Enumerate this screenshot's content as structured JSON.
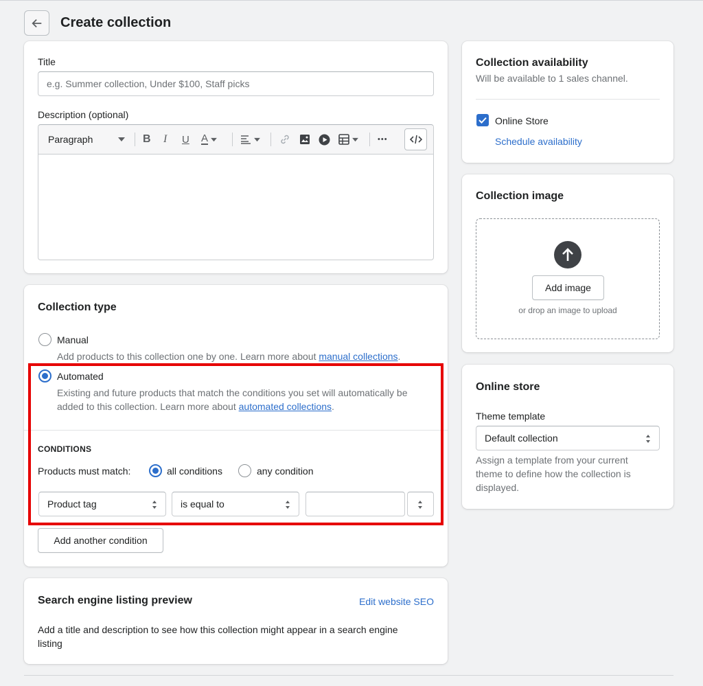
{
  "page": {
    "title": "Create collection",
    "back_icon": "arrow-left-icon"
  },
  "details": {
    "title_label": "Title",
    "title_placeholder": "e.g. Summer collection, Under $100, Staff picks",
    "description_label": "Description (optional)",
    "toolbar": {
      "paragraph_label": "Paragraph",
      "icons": [
        "bold-icon",
        "italic-icon",
        "underline-icon",
        "text-color-icon",
        "align-icon",
        "link-icon",
        "image-icon",
        "video-icon",
        "table-icon",
        "more-icon",
        "code-icon"
      ],
      "bold": "B",
      "italic": "I",
      "underline": "U",
      "text_color": "A",
      "more": "•••"
    }
  },
  "collection_type": {
    "title": "Collection type",
    "manual": {
      "label": "Manual",
      "desc": "Add products to this collection one by one. Learn more about",
      "link": "manual collections",
      "end": "."
    },
    "automated": {
      "label": "Automated",
      "desc_line1": "Existing and future products that match the conditions you set will automatically be",
      "desc_line2": "added to this collection. Learn more about",
      "link": "automated collections",
      "end": "."
    },
    "selected": "automated",
    "conditions_heading": "CONDITIONS",
    "match_label": "Products must match:",
    "match_all": "all conditions",
    "match_any": "any condition",
    "match_selected": "all",
    "condition_row": {
      "field": "Product tag",
      "operator": "is equal to",
      "value": ""
    },
    "add_condition": "Add another condition",
    "highlight_color": "#e60000"
  },
  "seo": {
    "title": "Search engine listing preview",
    "edit_link": "Edit website SEO",
    "desc_line1": "Add a title and description to see how this collection might appear in a search engine",
    "desc_line2": "listing"
  },
  "availability": {
    "title": "Collection availability",
    "subtitle": "Will be available to 1 sales channel.",
    "channel": "Online Store",
    "channel_checked": true,
    "schedule_link": "Schedule availability"
  },
  "image": {
    "title": "Collection image",
    "add_button": "Add image",
    "drop_hint": "or drop an image to upload",
    "upload_icon": "upload-arrow-icon"
  },
  "online_store": {
    "title": "Online store",
    "template_label": "Theme template",
    "template_value": "Default collection",
    "help_line1": "Assign a template from your current",
    "help_line2": "theme to define how the collection is",
    "help_line3": "displayed."
  },
  "colors": {
    "accent": "#2c6ecb",
    "checkbox": "#2c6ecb",
    "highlight": "#e60000"
  }
}
